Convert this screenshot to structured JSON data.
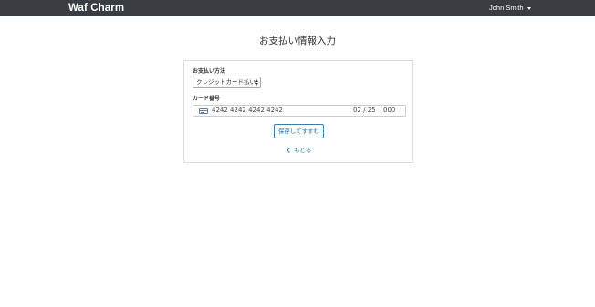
{
  "navbar": {
    "brand": "Waf Charm",
    "user_name": "John Smith",
    "user_menu_icon": "caret-down-icon"
  },
  "page": {
    "title": "お支払い情報入力"
  },
  "form": {
    "payment_method_label": "お支払い方法",
    "payment_method_value": "クレジットカード払い",
    "card_label": "カード番号",
    "card_icon": "credit-card-icon",
    "card_number": "4242 4242 4242 4242",
    "card_expiry": "02 / 25",
    "card_cvc": "000",
    "save_label": "保存してすすむ",
    "back_label": "もどる",
    "back_icon": "chevron-left-icon"
  },
  "colors": {
    "navbar_bg": "#383d41",
    "button_border": "#3a7ca5",
    "link": "#2a7ab0"
  }
}
